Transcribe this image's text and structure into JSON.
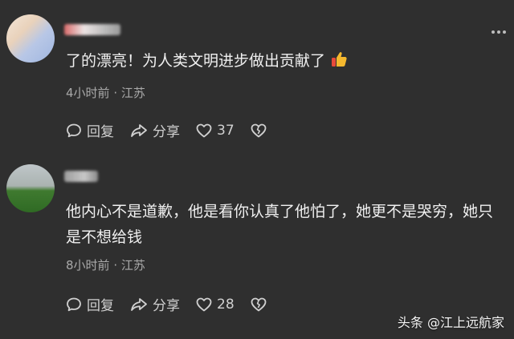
{
  "comments": [
    {
      "text": "了的漂亮！为人类文明进步做出贡献了",
      "time": "4小时前",
      "location": "江苏",
      "reply_label": "回复",
      "share_label": "分享",
      "likes": "37"
    },
    {
      "text": "他内心不是道歉，他是看你认真了他怕了，她更不是哭穷，她只是不想给钱",
      "time": "8小时前",
      "location": "江苏",
      "reply_label": "回复",
      "share_label": "分享",
      "likes": "28"
    }
  ],
  "meta_separator": "·",
  "watermark": "头条 @江上远航家",
  "colors": {
    "background": "#2f2f2f",
    "text": "#f0f0f0",
    "meta": "#a9a9a9",
    "thumb_yellow": "#f5b82e",
    "thumb_red": "#e84a3a"
  }
}
